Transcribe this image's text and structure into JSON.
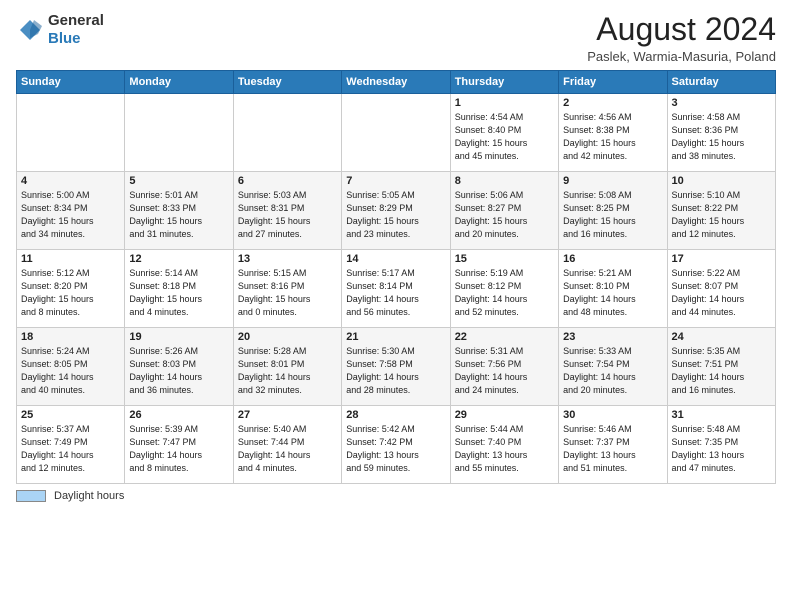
{
  "header": {
    "logo_general": "General",
    "logo_blue": "Blue",
    "month_title": "August 2024",
    "location": "Paslek, Warmia-Masuria, Poland"
  },
  "days_of_week": [
    "Sunday",
    "Monday",
    "Tuesday",
    "Wednesday",
    "Thursday",
    "Friday",
    "Saturday"
  ],
  "weeks": [
    [
      {
        "day": "",
        "info": ""
      },
      {
        "day": "",
        "info": ""
      },
      {
        "day": "",
        "info": ""
      },
      {
        "day": "",
        "info": ""
      },
      {
        "day": "1",
        "info": "Sunrise: 4:54 AM\nSunset: 8:40 PM\nDaylight: 15 hours\nand 45 minutes."
      },
      {
        "day": "2",
        "info": "Sunrise: 4:56 AM\nSunset: 8:38 PM\nDaylight: 15 hours\nand 42 minutes."
      },
      {
        "day": "3",
        "info": "Sunrise: 4:58 AM\nSunset: 8:36 PM\nDaylight: 15 hours\nand 38 minutes."
      }
    ],
    [
      {
        "day": "4",
        "info": "Sunrise: 5:00 AM\nSunset: 8:34 PM\nDaylight: 15 hours\nand 34 minutes."
      },
      {
        "day": "5",
        "info": "Sunrise: 5:01 AM\nSunset: 8:33 PM\nDaylight: 15 hours\nand 31 minutes."
      },
      {
        "day": "6",
        "info": "Sunrise: 5:03 AM\nSunset: 8:31 PM\nDaylight: 15 hours\nand 27 minutes."
      },
      {
        "day": "7",
        "info": "Sunrise: 5:05 AM\nSunset: 8:29 PM\nDaylight: 15 hours\nand 23 minutes."
      },
      {
        "day": "8",
        "info": "Sunrise: 5:06 AM\nSunset: 8:27 PM\nDaylight: 15 hours\nand 20 minutes."
      },
      {
        "day": "9",
        "info": "Sunrise: 5:08 AM\nSunset: 8:25 PM\nDaylight: 15 hours\nand 16 minutes."
      },
      {
        "day": "10",
        "info": "Sunrise: 5:10 AM\nSunset: 8:22 PM\nDaylight: 15 hours\nand 12 minutes."
      }
    ],
    [
      {
        "day": "11",
        "info": "Sunrise: 5:12 AM\nSunset: 8:20 PM\nDaylight: 15 hours\nand 8 minutes."
      },
      {
        "day": "12",
        "info": "Sunrise: 5:14 AM\nSunset: 8:18 PM\nDaylight: 15 hours\nand 4 minutes."
      },
      {
        "day": "13",
        "info": "Sunrise: 5:15 AM\nSunset: 8:16 PM\nDaylight: 15 hours\nand 0 minutes."
      },
      {
        "day": "14",
        "info": "Sunrise: 5:17 AM\nSunset: 8:14 PM\nDaylight: 14 hours\nand 56 minutes."
      },
      {
        "day": "15",
        "info": "Sunrise: 5:19 AM\nSunset: 8:12 PM\nDaylight: 14 hours\nand 52 minutes."
      },
      {
        "day": "16",
        "info": "Sunrise: 5:21 AM\nSunset: 8:10 PM\nDaylight: 14 hours\nand 48 minutes."
      },
      {
        "day": "17",
        "info": "Sunrise: 5:22 AM\nSunset: 8:07 PM\nDaylight: 14 hours\nand 44 minutes."
      }
    ],
    [
      {
        "day": "18",
        "info": "Sunrise: 5:24 AM\nSunset: 8:05 PM\nDaylight: 14 hours\nand 40 minutes."
      },
      {
        "day": "19",
        "info": "Sunrise: 5:26 AM\nSunset: 8:03 PM\nDaylight: 14 hours\nand 36 minutes."
      },
      {
        "day": "20",
        "info": "Sunrise: 5:28 AM\nSunset: 8:01 PM\nDaylight: 14 hours\nand 32 minutes."
      },
      {
        "day": "21",
        "info": "Sunrise: 5:30 AM\nSunset: 7:58 PM\nDaylight: 14 hours\nand 28 minutes."
      },
      {
        "day": "22",
        "info": "Sunrise: 5:31 AM\nSunset: 7:56 PM\nDaylight: 14 hours\nand 24 minutes."
      },
      {
        "day": "23",
        "info": "Sunrise: 5:33 AM\nSunset: 7:54 PM\nDaylight: 14 hours\nand 20 minutes."
      },
      {
        "day": "24",
        "info": "Sunrise: 5:35 AM\nSunset: 7:51 PM\nDaylight: 14 hours\nand 16 minutes."
      }
    ],
    [
      {
        "day": "25",
        "info": "Sunrise: 5:37 AM\nSunset: 7:49 PM\nDaylight: 14 hours\nand 12 minutes."
      },
      {
        "day": "26",
        "info": "Sunrise: 5:39 AM\nSunset: 7:47 PM\nDaylight: 14 hours\nand 8 minutes."
      },
      {
        "day": "27",
        "info": "Sunrise: 5:40 AM\nSunset: 7:44 PM\nDaylight: 14 hours\nand 4 minutes."
      },
      {
        "day": "28",
        "info": "Sunrise: 5:42 AM\nSunset: 7:42 PM\nDaylight: 13 hours\nand 59 minutes."
      },
      {
        "day": "29",
        "info": "Sunrise: 5:44 AM\nSunset: 7:40 PM\nDaylight: 13 hours\nand 55 minutes."
      },
      {
        "day": "30",
        "info": "Sunrise: 5:46 AM\nSunset: 7:37 PM\nDaylight: 13 hours\nand 51 minutes."
      },
      {
        "day": "31",
        "info": "Sunrise: 5:48 AM\nSunset: 7:35 PM\nDaylight: 13 hours\nand 47 minutes."
      }
    ]
  ],
  "footer": {
    "daylight_label": "Daylight hours"
  }
}
